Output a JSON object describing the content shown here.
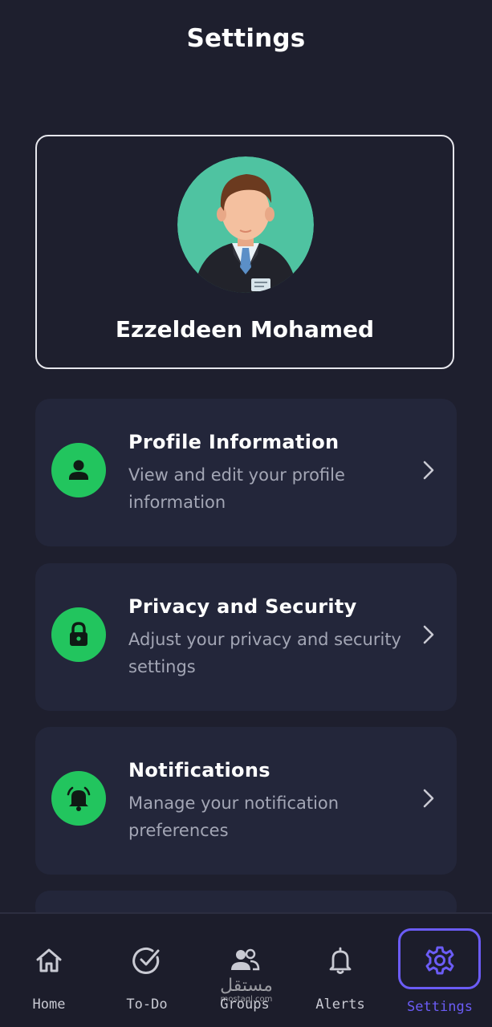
{
  "header": {
    "title": "Settings"
  },
  "profile": {
    "name": "Ezzeldeen Mohamed",
    "avatar_icon": "businessman-avatar",
    "avatar_bg": "#4fc3a1"
  },
  "settings_items": [
    {
      "title": "Profile Information",
      "description": "View and edit your profile information",
      "icon": "person-icon"
    },
    {
      "title": "Privacy and Security",
      "description": "Adjust your privacy and security settings",
      "icon": "lock-icon"
    },
    {
      "title": "Notifications",
      "description": "Manage your notification preferences",
      "icon": "bell-ring-icon"
    }
  ],
  "bottom_nav": {
    "items": [
      {
        "label": "Home",
        "icon": "home-icon",
        "active": false
      },
      {
        "label": "To-Do",
        "icon": "check-circle-icon",
        "active": false
      },
      {
        "label": "Groups",
        "icon": "people-icon",
        "active": false
      },
      {
        "label": "Alerts",
        "icon": "bell-icon",
        "active": false
      },
      {
        "label": "Settings",
        "icon": "gear-icon",
        "active": true
      }
    ]
  },
  "watermark": {
    "text": "مستقل",
    "subtext": "mostaql.com"
  },
  "colors": {
    "background": "#1e1f2e",
    "card": "#23263a",
    "accent_green": "#22c55e",
    "accent_purple": "#6b5cf6"
  }
}
